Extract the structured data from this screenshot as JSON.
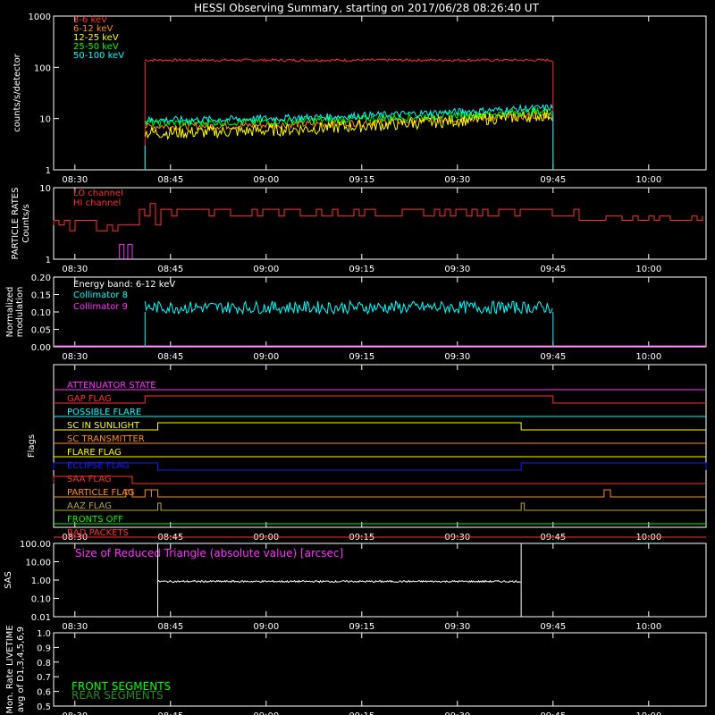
{
  "title": "HESSI Observing Summary, starting on 2017/06/28 08:26:40 UT",
  "colors": {
    "background": "#000000",
    "axes": "#ffffff",
    "red": "#ff3030",
    "orange": "#ff8c1a",
    "yellow": "#ffff00",
    "green": "#00ff00",
    "cyan": "#00ffff",
    "magenta": "#ff30ff",
    "blue": "#1a1aff",
    "olive": "#b5a642",
    "white": "#ffffff"
  },
  "time_ticks": [
    "08:30",
    "08:45",
    "09:00",
    "09:15",
    "09:30",
    "09:45",
    "10:00"
  ],
  "chart_data": [
    {
      "type": "line",
      "panel": "count-rates",
      "ylabel": "counts/s/detector",
      "yscale": "log",
      "ylim": [
        1,
        1000
      ],
      "yticks": [
        "1",
        "10",
        "100",
        "1000"
      ],
      "xlim": [
        "08:26:40",
        "10:09:00"
      ],
      "series": [
        {
          "name": "3-6 keV",
          "color": "#ff3030",
          "start": "08:41",
          "end": "09:45",
          "level": 130
        },
        {
          "name": "6-12 keV",
          "color": "#ff8c1a",
          "start": "08:41",
          "end": "09:45",
          "level_start": 6,
          "level_end": 10
        },
        {
          "name": "12-25 keV",
          "color": "#ffff00",
          "start": "08:41",
          "end": "09:45",
          "level_start": 4,
          "level_end": 9
        },
        {
          "name": "25-50 keV",
          "color": "#00ff00",
          "start": "08:41",
          "end": "09:45",
          "level_start": 7,
          "level_end": 12
        },
        {
          "name": "50-100 keV",
          "color": "#00ffff",
          "start": "08:41",
          "end": "09:45",
          "level_start": 8,
          "level_end": 14
        }
      ]
    },
    {
      "type": "line",
      "panel": "particle-rates",
      "ylabel": "PARTICLE RATES Counts/s",
      "yscale": "log",
      "ylim": [
        1,
        10
      ],
      "yticks": [
        "1",
        "10"
      ],
      "series": [
        {
          "name": "LO channel",
          "color": "#ff3030",
          "points": [
            [
              "08:26:40",
              3
            ],
            [
              "08:30",
              2.5
            ],
            [
              "08:34",
              3
            ],
            [
              "08:38",
              5
            ],
            [
              "08:40",
              3
            ],
            [
              "08:42",
              2.5
            ],
            [
              "08:44",
              4
            ],
            [
              "09:45",
              4
            ],
            [
              "09:46",
              3.5
            ],
            [
              "10:09",
              3.5
            ]
          ]
        },
        {
          "name": "HI channel",
          "color": "#ff3030",
          "points": [
            [
              "08:37",
              1.6
            ],
            [
              "08:39",
              1.6
            ]
          ]
        }
      ]
    },
    {
      "type": "line",
      "panel": "modulation",
      "ylabel": "Normalized modulation",
      "ylim": [
        0,
        0.2
      ],
      "yticks": [
        "0.00",
        "0.05",
        "0.10",
        "0.15",
        "0.20"
      ],
      "annotation": "Energy band: 6-12 keV",
      "series": [
        {
          "name": "Collimator 8",
          "color": "#00ffff",
          "start": "08:41",
          "end": "09:45",
          "level": 0.105
        },
        {
          "name": "Collimator 9",
          "color": "#ff30ff",
          "start": "08:26:40",
          "end": "10:09",
          "level": 0.0
        }
      ]
    },
    {
      "type": "line",
      "panel": "flags",
      "ylabel": "Flags",
      "flags": [
        {
          "name": "ATTENUATOR STATE",
          "color": "#ff30ff",
          "segments": []
        },
        {
          "name": "SAA FLAG",
          "color": "#ff3030",
          "segments": [
            [
              "08:41",
              "09:45"
            ]
          ]
        },
        {
          "name": "POSSIBLE FLARE",
          "color": "#00ffff",
          "segments": []
        },
        {
          "name": "SC IN SUNLIGHT",
          "color": "#ffff00",
          "segments": [
            [
              "08:43",
              "09:40"
            ]
          ]
        },
        {
          "name": "SC TRANSMITTER",
          "color": "#ff8c1a",
          "segments": []
        },
        {
          "name": "FLARE FLAG",
          "color": "#ffff00",
          "segments": []
        },
        {
          "name": "ECLIPSE FLAG",
          "color": "#1a1aff",
          "segments": [
            [
              "08:26:40",
              "08:43"
            ],
            [
              "09:40",
              "10:09"
            ]
          ]
        },
        {
          "name": "SAA FLAG",
          "color": "#ff3030",
          "segments": [
            [
              "08:26:40",
              "08:39"
            ]
          ]
        },
        {
          "name": "PARTICLE FLAG",
          "color": "#ff8c1a",
          "segments": [
            [
              "08:38",
              "08:39"
            ],
            [
              "08:41",
              "08:42"
            ],
            [
              "08:42",
              "08:43"
            ],
            [
              "09:53",
              "09:54"
            ]
          ]
        },
        {
          "name": "AAZ FLAG",
          "color": "#b5a642",
          "segments": [
            [
              "08:43",
              "08:43:30"
            ],
            [
              "09:40",
              "09:40:30"
            ]
          ]
        },
        {
          "name": "FRONTS OFF",
          "color": "#00ff00",
          "segments": []
        },
        {
          "name": "BAD PACKETS",
          "color": "#ff3030",
          "segments": []
        }
      ]
    },
    {
      "type": "line",
      "panel": "sas",
      "ylabel": "SAS",
      "yscale": "log",
      "ylim": [
        0.01,
        100
      ],
      "yticks": [
        "0.01",
        "0.10",
        "1.00",
        "10.00",
        "100.00"
      ],
      "annotation": "Size of Reduced Triangle (absolute value) [arcsec]",
      "series": [
        {
          "name": "SAS",
          "color": "#ffffff",
          "start": "08:43",
          "end": "09:40",
          "level": 0.7
        }
      ]
    },
    {
      "type": "line",
      "panel": "livetime",
      "ylabel": "Mon. Rate LIVETIME avg of D1,3,4,5,6,9",
      "ylim": [
        0.5,
        1.0
      ],
      "yticks": [
        "0.5",
        "0.6",
        "0.7",
        "0.8",
        "0.9",
        "1.0"
      ],
      "series": [
        {
          "name": "FRONT SEGMENTS",
          "color": "#00ff00"
        },
        {
          "name": "REAR SEGMENTS",
          "color": "#228b22"
        }
      ]
    }
  ]
}
